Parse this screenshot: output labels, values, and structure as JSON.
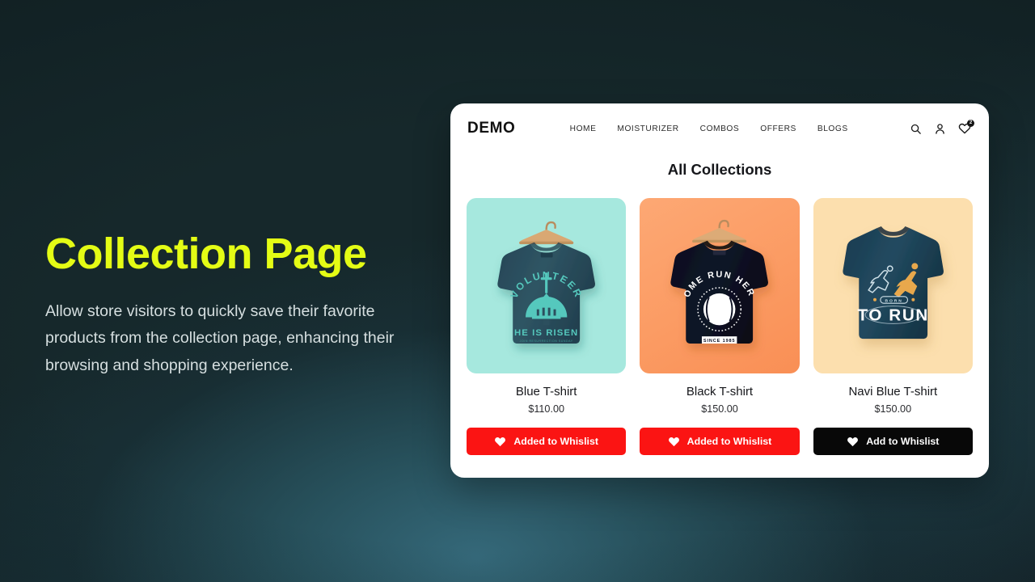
{
  "hero": {
    "title": "Collection Page",
    "description": "Allow store visitors to quickly save their favorite products from the collection page, enhancing their browsing and shopping experience.",
    "title_color": "#e4fc15",
    "text_color": "#d6dfe0"
  },
  "background": {
    "base_color": "#16282b",
    "glow_color": "#35697a"
  },
  "store": {
    "brand": "DEMO",
    "nav": [
      {
        "label": "HOME"
      },
      {
        "label": "MOISTURIZER"
      },
      {
        "label": "COMBOS"
      },
      {
        "label": "OFFERS"
      },
      {
        "label": "BLOGS"
      }
    ],
    "icons": [
      {
        "name": "search-icon"
      },
      {
        "name": "user-account-icon"
      },
      {
        "name": "wishlist-heart-icon"
      }
    ],
    "wishlist_count": "2",
    "section_title": "All Collections",
    "products": [
      {
        "name": "Blue T-shirt",
        "price": "$110.00",
        "bg_color": "#a6e8de",
        "shirt_color": "#2c4f5e",
        "print_color": "#55c8bd",
        "print_top": "VOLUNTEER",
        "print_bottom": "HE IS RISEN",
        "print_sub": "JOIN RESURRECTION SUNDAY",
        "button": {
          "label": "Added  to Whislist",
          "state": "added",
          "color": "#fb1413"
        }
      },
      {
        "name": "Black T-shirt",
        "price": "$150.00",
        "bg_color": "#fb9b63",
        "shirt_color": "#0c1023",
        "print_color": "#ffffff",
        "print_top": "HOME RUN HERO",
        "print_bottom": "SINCE 1985",
        "print_sub": "",
        "button": {
          "label": "Added  to Whislist",
          "state": "added",
          "color": "#fb1413"
        }
      },
      {
        "name": "Navi Blue T-shirt",
        "price": "$150.00",
        "bg_color": "#fcdfae",
        "shirt_color": "#1e4257",
        "print_color": "#ffffff",
        "print_top": "BORN",
        "print_bottom": "TO RUN",
        "print_sub": "",
        "accent_color": "#e8a84c",
        "button": {
          "label": "Add to Whislist",
          "state": "not-added",
          "color": "#080808"
        }
      }
    ]
  }
}
